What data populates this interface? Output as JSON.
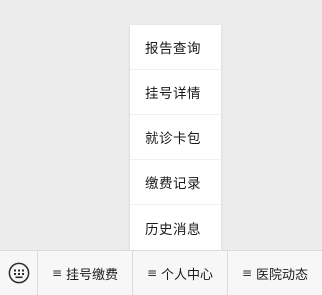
{
  "popup_menu": {
    "items": [
      {
        "label": "报告查询"
      },
      {
        "label": "挂号详情"
      },
      {
        "label": "就诊卡包"
      },
      {
        "label": "缴费记录"
      },
      {
        "label": "历史消息"
      }
    ]
  },
  "bottom_bar": {
    "keyboard_icon": "keyboard-icon",
    "menu_icon": "≡",
    "tabs": [
      {
        "label": "挂号缴费"
      },
      {
        "label": "个人中心"
      },
      {
        "label": "医院动态"
      }
    ]
  }
}
